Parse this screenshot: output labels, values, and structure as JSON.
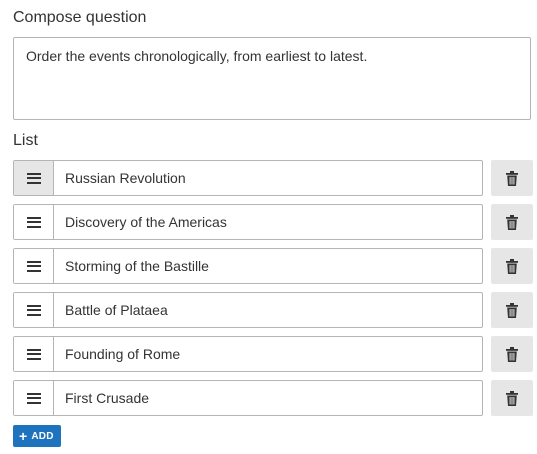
{
  "compose": {
    "title": "Compose question",
    "question_text": "Order the events chronologically, from earliest to latest."
  },
  "list": {
    "title": "List",
    "items": [
      {
        "label": "Russian Revolution"
      },
      {
        "label": "Discovery of the Americas"
      },
      {
        "label": "Storming of the Bastille"
      },
      {
        "label": "Battle of Plataea"
      },
      {
        "label": "Founding of Rome"
      },
      {
        "label": "First Crusade"
      }
    ],
    "active_index": 0
  },
  "add_button": {
    "icon": "+",
    "label": "ADD"
  },
  "icons": {
    "drag": "drag-handle-icon",
    "delete": "trash-icon"
  },
  "colors": {
    "accent": "#1e73be",
    "button_bg": "#e6e6e6",
    "border": "#b5b5b5"
  }
}
